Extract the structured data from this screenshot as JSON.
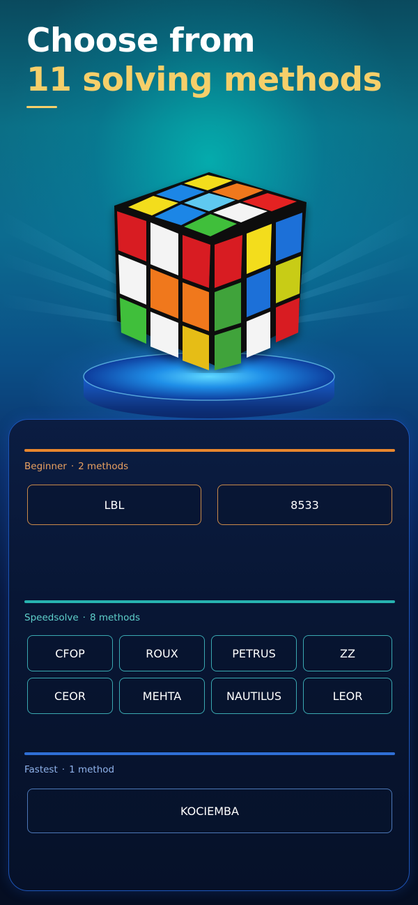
{
  "headline": {
    "line1": "Choose from",
    "line2": "11 solving methods",
    "accent_color": "#f6cf6a"
  },
  "hero": {
    "icon": "rubiks-cube-icon",
    "pedestal": "glowing-pedestal"
  },
  "groups": [
    {
      "name": "Beginner",
      "count_label": "2 methods",
      "color": "#e8872e",
      "methods": [
        "LBL",
        "8533"
      ]
    },
    {
      "name": "Speedsolve",
      "count_label": "8 methods",
      "color": "#27b3b0",
      "methods": [
        "CFOP",
        "ROUX",
        "PETRUS",
        "ZZ",
        "CEOR",
        "MEHTA",
        "NAUTILUS",
        "LEOR"
      ]
    },
    {
      "name": "Fastest",
      "count_label": "1 method",
      "color": "#2f6fd6",
      "methods": [
        "KOCIEMBA"
      ]
    }
  ]
}
